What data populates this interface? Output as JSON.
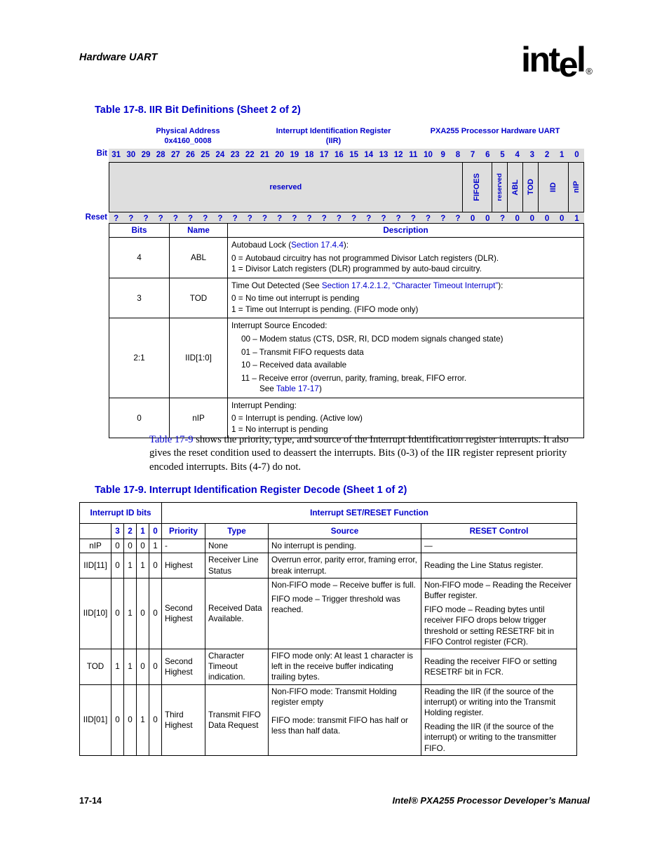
{
  "header": {
    "running_head": "Hardware UART",
    "logo_text": "intel",
    "logo_reg": "®"
  },
  "table_17_8": {
    "caption": "Table 17-8. IIR Bit Definitions (Sheet 2 of 2)",
    "register": {
      "title_left_line1": "Physical Address",
      "title_left_line2": "0x4160_0008",
      "title_center_line1": "Interrupt Identification Register",
      "title_center_line2": "(IIR)",
      "title_right": "PXA255 Processor Hardware UART",
      "bit_label": "Bit",
      "reset_label": "Reset",
      "bits": [
        "31",
        "30",
        "29",
        "28",
        "27",
        "26",
        "25",
        "24",
        "23",
        "22",
        "21",
        "20",
        "19",
        "18",
        "17",
        "16",
        "15",
        "14",
        "13",
        "12",
        "11",
        "10",
        "9",
        "8",
        "7",
        "6",
        "5",
        "4",
        "3",
        "2",
        "1",
        "0"
      ],
      "reset_values": [
        "?",
        "?",
        "?",
        "?",
        "?",
        "?",
        "?",
        "?",
        "?",
        "?",
        "?",
        "?",
        "?",
        "?",
        "?",
        "?",
        "?",
        "?",
        "?",
        "?",
        "?",
        "?",
        "?",
        "?",
        "0",
        "0",
        "?",
        "0",
        "0",
        "0",
        "0",
        "1"
      ],
      "fields": [
        {
          "name": "reserved",
          "span": 24,
          "orient": "horizontal"
        },
        {
          "name": "FIFOES",
          "span": 2,
          "orient": "vertical"
        },
        {
          "name": "reserved",
          "span": 1,
          "orient": "vertical-small"
        },
        {
          "name": "ABL",
          "span": 1,
          "orient": "vertical"
        },
        {
          "name": "TOD",
          "span": 1,
          "orient": "vertical"
        },
        {
          "name": "IID",
          "span": 2,
          "orient": "vertical"
        },
        {
          "name": "nIP",
          "span": 1,
          "orient": "vertical"
        }
      ]
    },
    "columns": [
      "Bits",
      "Name",
      "Description"
    ],
    "rows": [
      {
        "bits": "4",
        "name": "ABL",
        "lead_pre": "Autobaud Lock (",
        "lead_link": "Section 17.4.4",
        "lead_post": "):",
        "options": [
          {
            "key": "0 =",
            "text": "Autobaud circuitry has not programmed Divisor Latch registers (DLR)."
          },
          {
            "key": "1 =",
            "text": "Divisor Latch registers (DLR) programmed by auto-baud circuitry."
          }
        ]
      },
      {
        "bits": "3",
        "name": "TOD",
        "lead_pre": "Time Out Detected (See ",
        "lead_link": "Section 17.4.2.1.2, “Character Timeout Interrupt”",
        "lead_post": "):",
        "options": [
          {
            "key": "0 =",
            "text": "No time out interrupt is pending"
          },
          {
            "key": "1 =",
            "text": "Time out Interrupt is pending. (FIFO mode only)"
          }
        ]
      },
      {
        "bits": "2:1",
        "name": "IID[1:0]",
        "lead_pre": "Interrupt Source Encoded:",
        "lead_link": "",
        "lead_post": "",
        "encoded": [
          "00 – Modem status (CTS, DSR, RI, DCD modem signals changed state)",
          "01 – Transmit FIFO requests data",
          "10 – Received data available"
        ],
        "encoded_last_pre": "11 – Receive error (overrun, parity, framing, break, FIFO error.",
        "encoded_last_see": "See ",
        "encoded_last_link": "Table 17-17",
        "encoded_last_post": ")"
      },
      {
        "bits": "0",
        "name": "nIP",
        "lead_pre": "Interrupt Pending:",
        "lead_link": "",
        "lead_post": "",
        "options": [
          {
            "key": "0 =",
            "text": "Interrupt is pending. (Active low)"
          },
          {
            "key": "1 =",
            "text": "No interrupt is pending"
          }
        ]
      }
    ]
  },
  "body_paragraph": {
    "link": "Table 17-9",
    "text": " shows the priority, type, and source of the Interrupt Identification register interrupts. It also gives the reset condition used to deassert the interrupts. Bits (0-3) of the IIR register represent priority encoded interrupts. Bits (4-7) do not."
  },
  "table_17_9": {
    "caption": "Table 17-9. Interrupt Identification Register Decode (Sheet 1 of 2)",
    "group_header_left": "Interrupt ID bits",
    "group_header_right": "Interrupt SET/RESET Function",
    "columns": {
      "id": "",
      "bit3": "3",
      "bit2": "2",
      "bit1": "1",
      "bit0": "0",
      "priority": "Priority",
      "type": "Type",
      "source": "Source",
      "reset_control": "RESET Control"
    },
    "rows": [
      {
        "id": "nIP",
        "bit3": "0",
        "bit2": "0",
        "bit1": "0",
        "bit0": "1",
        "priority": "-",
        "type": "None",
        "source": [
          "No interrupt is pending."
        ],
        "reset_control": [
          "—"
        ]
      },
      {
        "id": "IID[11]",
        "bit3": "0",
        "bit2": "1",
        "bit1": "1",
        "bit0": "0",
        "priority": "Highest",
        "type": "Receiver Line Status",
        "source": [
          "Overrun error, parity error, framing error, break interrupt."
        ],
        "reset_control": [
          "Reading the Line Status register."
        ]
      },
      {
        "id": "IID[10]",
        "bit3": "0",
        "bit2": "1",
        "bit1": "0",
        "bit0": "0",
        "priority": "Second Highest",
        "type": "Received Data Available.",
        "source": [
          "Non-FIFO mode – Receive buffer is full.",
          "FIFO mode – Trigger threshold was reached."
        ],
        "reset_control": [
          "Non-FIFO mode – Reading the Receiver Buffer register.",
          "FIFO mode – Reading bytes until receiver FIFO drops below trigger threshold or setting RESETRF bit in FIFO Control register (FCR)."
        ]
      },
      {
        "id": "TOD",
        "bit3": "1",
        "bit2": "1",
        "bit1": "0",
        "bit0": "0",
        "priority": "Second Highest",
        "type": "Character Timeout indication.",
        "source": [
          "FIFO mode only: At least 1 character is left in the receive buffer indicating trailing bytes."
        ],
        "reset_control": [
          "Reading the receiver FIFO or setting RESETRF bit in FCR."
        ]
      },
      {
        "id": "IID[01]",
        "bit3": "0",
        "bit2": "0",
        "bit1": "1",
        "bit0": "0",
        "priority": "Third Highest",
        "type": "Transmit FIFO Data Request",
        "source": [
          "Non-FIFO mode: Transmit Holding register empty",
          "FIFO mode: transmit FIFO has half or less than half data."
        ],
        "reset_control": [
          "Reading the IIR (if the source of the interrupt) or writing into the Transmit Holding register.",
          "Reading the IIR (if the source of the interrupt) or writing to the transmitter FIFO."
        ]
      }
    ]
  },
  "footer": {
    "page_number": "17-14",
    "manual_title": "Intel® PXA255 Processor Developer’s Manual"
  }
}
